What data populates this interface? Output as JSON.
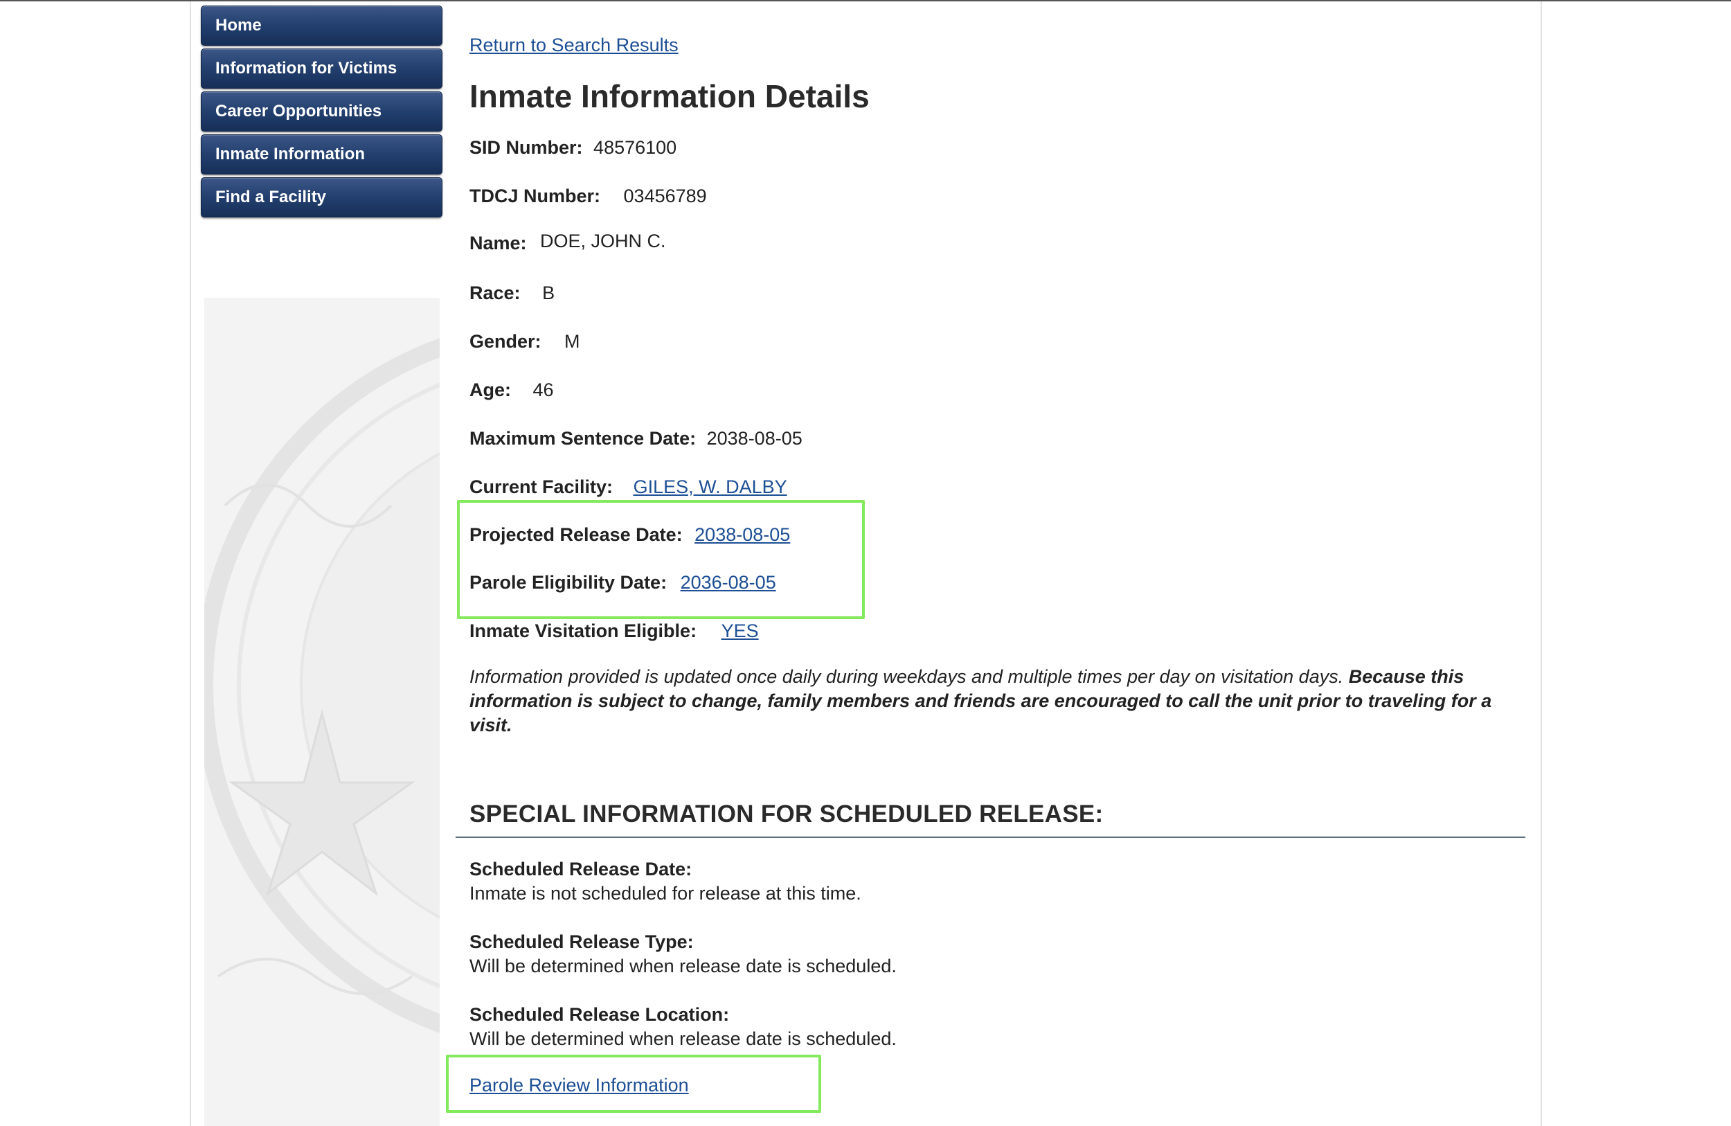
{
  "sidebar": {
    "items": [
      {
        "label": "Home"
      },
      {
        "label": "Information for Victims"
      },
      {
        "label": "Career Opportunities"
      },
      {
        "label": "Inmate Information"
      },
      {
        "label": "Find a Facility"
      }
    ]
  },
  "main": {
    "return_link": "Return to Search Results",
    "title": "Inmate Information Details",
    "fields": {
      "sid": {
        "label": "SID Number:",
        "value": "48576100"
      },
      "tdcj": {
        "label": "TDCJ Number:",
        "value": "03456789"
      },
      "name": {
        "label": "Name:",
        "value": "DOE, JOHN C."
      },
      "race": {
        "label": "Race:",
        "value": "B"
      },
      "gender": {
        "label": "Gender:",
        "value": "M"
      },
      "age": {
        "label": "Age:",
        "value": "46"
      },
      "max_sentence": {
        "label": "Maximum Sentence Date:",
        "value": "2038-08-05"
      },
      "facility": {
        "label": "Current Facility:",
        "value": "GILES, W. DALBY"
      },
      "projected_release": {
        "label": "Projected Release Date:",
        "value": "2038-08-05"
      },
      "parole_eligibility": {
        "label": "Parole Eligibility Date:",
        "value": "2036-08-05"
      },
      "visitation": {
        "label": "Inmate Visitation Eligible:",
        "value": "YES"
      }
    },
    "note": {
      "text": "Information provided is updated once daily during weekdays and multiple times per day on visitation days.",
      "bold_text": "Because this information is subject to change, family members and friends are encouraged to call the unit prior to traveling for a visit."
    },
    "special_section": {
      "title": "SPECIAL INFORMATION FOR SCHEDULED RELEASE:",
      "items": [
        {
          "label": "Scheduled Release Date:",
          "value": "Inmate is not scheduled for release at this time."
        },
        {
          "label": "Scheduled Release Type:",
          "value": "Will be determined when release date is scheduled."
        },
        {
          "label": "Scheduled Release Location:",
          "value": "Will be determined when release date is scheduled."
        }
      ]
    },
    "parole_link": "Parole Review Information"
  },
  "colors": {
    "nav_button": "#23406f",
    "link": "#1d4f95",
    "highlight": "#84e95d"
  }
}
